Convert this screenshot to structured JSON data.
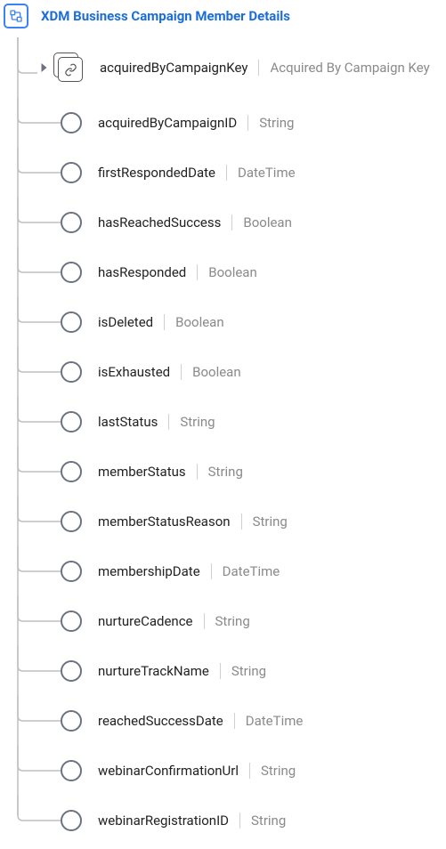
{
  "root": {
    "title": "XDM Business Campaign Member Details"
  },
  "firstChild": {
    "name": "acquiredByCampaignKey",
    "type": "Acquired By Campaign Key"
  },
  "fields": [
    {
      "name": "acquiredByCampaignID",
      "type": "String"
    },
    {
      "name": "firstRespondedDate",
      "type": "DateTime"
    },
    {
      "name": "hasReachedSuccess",
      "type": "Boolean"
    },
    {
      "name": "hasResponded",
      "type": "Boolean"
    },
    {
      "name": "isDeleted",
      "type": "Boolean"
    },
    {
      "name": "isExhausted",
      "type": "Boolean"
    },
    {
      "name": "lastStatus",
      "type": "String"
    },
    {
      "name": "memberStatus",
      "type": "String"
    },
    {
      "name": "memberStatusReason",
      "type": "String"
    },
    {
      "name": "membershipDate",
      "type": "DateTime"
    },
    {
      "name": "nurtureCadence",
      "type": "String"
    },
    {
      "name": "nurtureTrackName",
      "type": "String"
    },
    {
      "name": "reachedSuccessDate",
      "type": "DateTime"
    },
    {
      "name": "webinarConfirmationUrl",
      "type": "String"
    },
    {
      "name": "webinarRegistrationID",
      "type": "String"
    }
  ]
}
